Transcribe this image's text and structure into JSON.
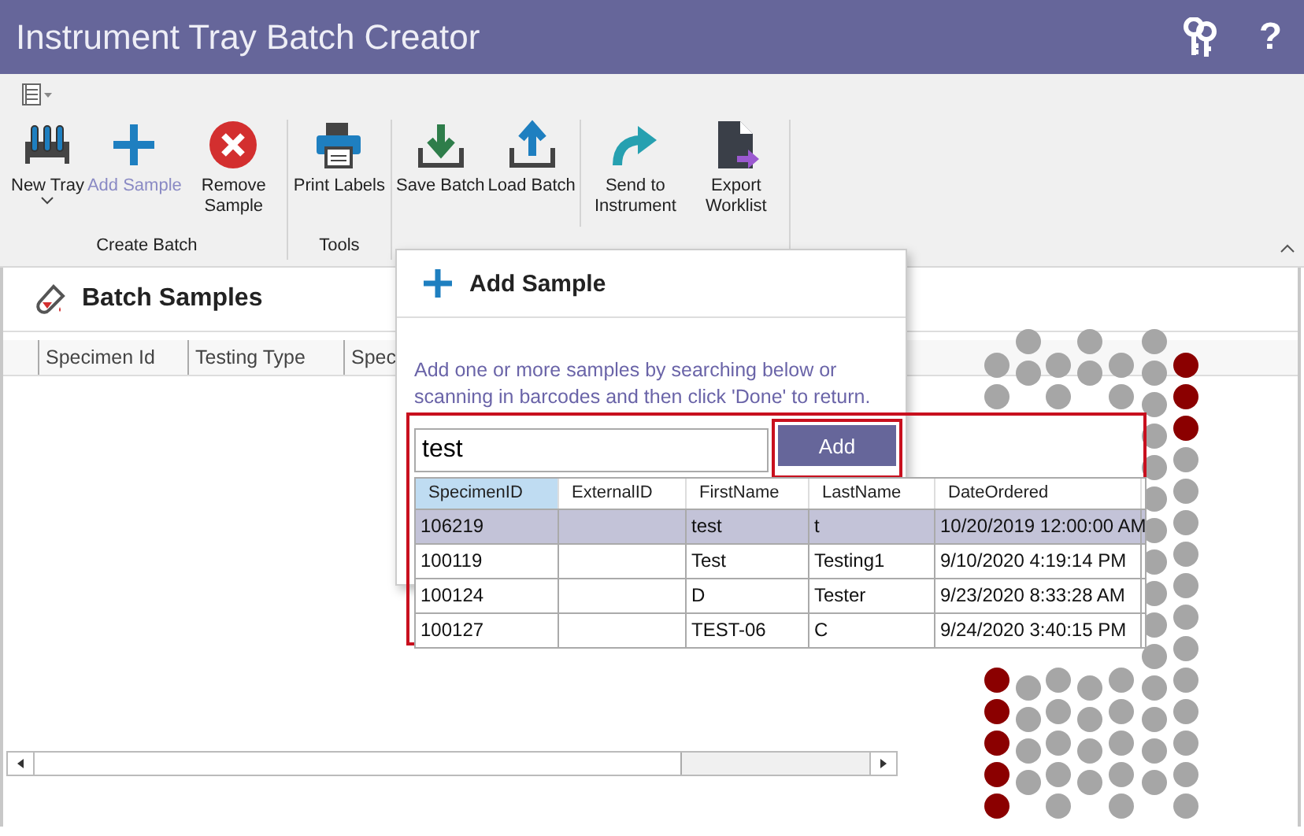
{
  "window": {
    "title": "Instrument Tray Batch Creator",
    "help": "?"
  },
  "ribbon": {
    "groups": [
      {
        "label": "Create Batch",
        "sets": [
          [
            {
              "label": "New Tray",
              "kind": "tray",
              "dropdown": true,
              "disabled": false
            },
            {
              "label": "Add Sample",
              "kind": "plus",
              "dropdown": false,
              "disabled": true
            },
            {
              "label": "Remove Sample",
              "kind": "remove",
              "dropdown": false,
              "disabled": false
            }
          ]
        ]
      },
      {
        "label": "Tools",
        "sets": [
          [
            {
              "label": "Print Labels",
              "kind": "print",
              "dropdown": false,
              "disabled": false
            }
          ]
        ]
      },
      {
        "sets": [
          [
            {
              "label": "Save Batch",
              "kind": "save",
              "dropdown": false,
              "disabled": false
            },
            {
              "label": "Load Batch",
              "kind": "load",
              "dropdown": false,
              "disabled": false
            }
          ],
          [
            {
              "label": "Send to Instrument",
              "kind": "send",
              "dropdown": false,
              "disabled": false
            },
            {
              "label": "Export Worklist",
              "kind": "export",
              "dropdown": false,
              "disabled": false
            }
          ]
        ]
      }
    ]
  },
  "panel": {
    "title": "Batch Samples",
    "columns": [
      "Specimen Id",
      "Testing Type",
      "Spec"
    ]
  },
  "dialog": {
    "title": "Add Sample",
    "instructions": "Add one or more samples by searching below or scanning in barcodes and then click 'Done' to return.",
    "search": {
      "value": "test"
    },
    "add_button": "Add",
    "results": {
      "columns": [
        {
          "label": "SpecimenID",
          "highlighted": true
        },
        {
          "label": "ExternalID",
          "highlighted": false
        },
        {
          "label": "FirstName",
          "highlighted": false
        },
        {
          "label": "LastName",
          "highlighted": false
        },
        {
          "label": "DateOrdered",
          "highlighted": false
        }
      ],
      "rows": [
        {
          "selected": true,
          "cells": [
            "106219",
            "",
            "test",
            "t",
            "10/20/2019 12:00:00 AM"
          ]
        },
        {
          "selected": false,
          "cells": [
            "100119",
            "",
            "Test",
            "Testing1",
            "9/10/2020 4:19:14 PM"
          ]
        },
        {
          "selected": false,
          "cells": [
            "100124",
            "",
            "D",
            "Tester",
            "9/23/2020 8:33:28 AM"
          ]
        },
        {
          "selected": false,
          "cells": [
            "100127",
            "",
            "TEST-06",
            "C",
            "9/24/2020 3:40:15 PM"
          ]
        }
      ]
    }
  }
}
